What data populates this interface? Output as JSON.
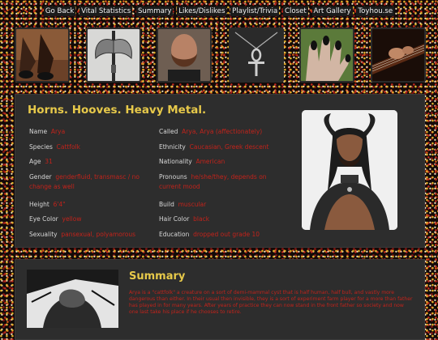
{
  "nav": [
    "Go Back",
    "Vital Statistics",
    "Summary",
    "Likes/Dislikes",
    "Playlist/Trivia",
    "Closet",
    "Art Gallery",
    "Toyhou.se"
  ],
  "title": "Horns. Hooves. Heavy Metal.",
  "stats_left": [
    {
      "label": "Name",
      "value": "Arya"
    },
    {
      "label": "Species",
      "value": "Cattfolk"
    },
    {
      "label": "Age",
      "value": "31"
    },
    {
      "label": "Gender",
      "value": "genderfluid, transmasc / no change as well"
    },
    {
      "label": "Height",
      "value": "6'4\""
    },
    {
      "label": "Eye Color",
      "value": "yellow"
    },
    {
      "label": "Sexuality",
      "value": "pansexual, polyamorous"
    }
  ],
  "stats_right": [
    {
      "label": "Called",
      "value": "Arya, Arya (affectionately)"
    },
    {
      "label": "Ethnicity",
      "value": "Caucasian, Greek descent"
    },
    {
      "label": "Nationality",
      "value": "American"
    },
    {
      "label": "Pronouns",
      "value": "he/she/they, depends on current mood"
    },
    {
      "label": "Build",
      "value": "muscular"
    },
    {
      "label": "Hair Color",
      "value": "black"
    },
    {
      "label": "Education",
      "value": "dropped out grade 10"
    }
  ],
  "summary": {
    "title": "Summary",
    "text": "Arya is a \"cattfolk\" a creature on a sort of demi-mammal cyst that is half human, half bull, and vastly more dangerous than either. In their usual then invisible, they is a sort of experiment farm player for a more than father has played in for many years. After years of practice they can now stand in the front father so society and now one last take his place if he chooses to retire."
  }
}
